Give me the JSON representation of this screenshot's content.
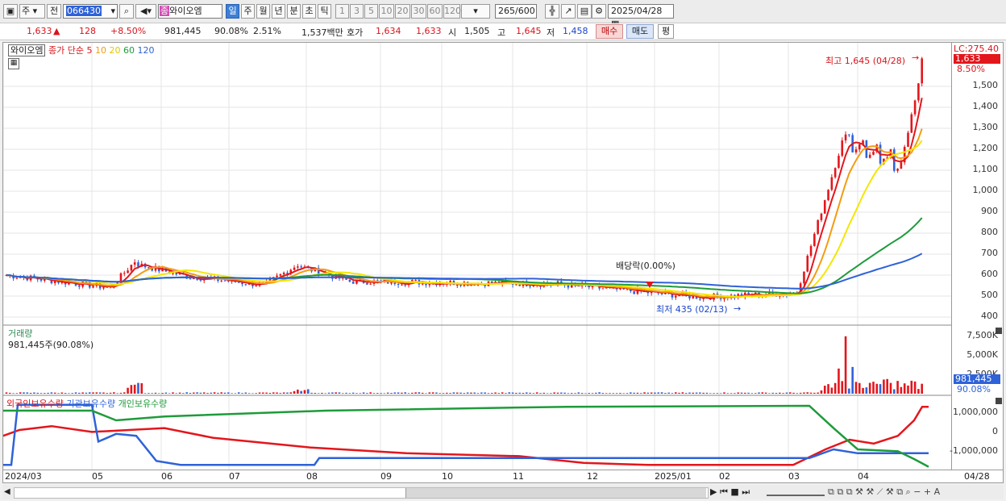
{
  "toolbar": {
    "market_mode": "주",
    "prev_label": "전",
    "code": "066430",
    "stock_name": "와이오엠",
    "stock_badge": "종",
    "periods": [
      "일",
      "주",
      "월",
      "년",
      "분",
      "초",
      "틱"
    ],
    "intervals": [
      "1",
      "3",
      "5",
      "10",
      "20",
      "30",
      "60",
      "120"
    ],
    "count_value": "265",
    "count_total": "/600",
    "date": "2025/04/28"
  },
  "quote": {
    "price": "1,633",
    "change": "128",
    "change_pct": "+8.50%",
    "volume": "981,445",
    "volume_ratio": "90.08%",
    "turnover": "2.51%",
    "amount": "1,537백만",
    "bid_label": "호가",
    "bid1": "1,634",
    "bid2": "1,633",
    "open_label": "시",
    "open": "1,505",
    "high_label": "고",
    "high": "1,645",
    "low_label": "저",
    "low": "1,458",
    "buy_label": "매수",
    "sell_label": "매도",
    "eval_label": "평"
  },
  "price_panel": {
    "name_tag": "와이오엠",
    "legend_close": "종가 단순",
    "ma": [
      {
        "label": "5",
        "color": "#e3161c"
      },
      {
        "label": "10",
        "color": "#f39c12"
      },
      {
        "label": "20",
        "color": "#f5e600"
      },
      {
        "label": "60",
        "color": "#1e9b3a"
      },
      {
        "label": "120",
        "color": "#2f62d8"
      }
    ],
    "high_note": "최고 1,645 (04/28)",
    "low_note": "최저 435 (02/13)",
    "dividend_note": "배당락(0.00%)",
    "lc_label": "LC:275.40",
    "last_tag": "1,633",
    "pct_tag": "8.50%",
    "y_ticks": [
      "1,500",
      "1,400",
      "1,300",
      "1,200",
      "1,100",
      "1,000",
      "900",
      "800",
      "700",
      "600",
      "500",
      "400"
    ]
  },
  "volume_panel": {
    "title": "거래량",
    "info": "981,445주(90.08%)",
    "y_ticks": [
      "7,500K",
      "5,000K",
      "2,500K"
    ],
    "last_tag": "981,445",
    "pct_tag": "90.08%"
  },
  "holding_panel": {
    "legend": [
      "외국인보유수량",
      "기관보유수량",
      "개인보유수량"
    ],
    "colors": [
      "#e3161c",
      "#2f62d8",
      "#1e9b3a"
    ],
    "y_ticks": [
      "1,000,000",
      "0",
      "-1,000,000"
    ]
  },
  "x_axis": {
    "labels": [
      "2024/03",
      "05",
      "06",
      "07",
      "08",
      "09",
      "10",
      "11",
      "12",
      "2025/01",
      "02",
      "03",
      "04"
    ],
    "end_label": "04/28"
  },
  "chart_data": {
    "type": "candlestick",
    "symbol": "066430",
    "name": "와이오엠",
    "period": "daily",
    "last_close": 1633,
    "high": {
      "value": 1645,
      "date": "04/28"
    },
    "low": {
      "value": 435,
      "date": "02/13"
    },
    "y_range": [
      400,
      1650
    ],
    "ma_end_values": {
      "5": 1400,
      "10": 1300,
      "20": 1220,
      "60": 820,
      "120": 675
    },
    "volume_last": 981445
  },
  "bottom_tools": [
    "◀",
    "▶",
    "⏮",
    "⏹",
    "⏭"
  ]
}
